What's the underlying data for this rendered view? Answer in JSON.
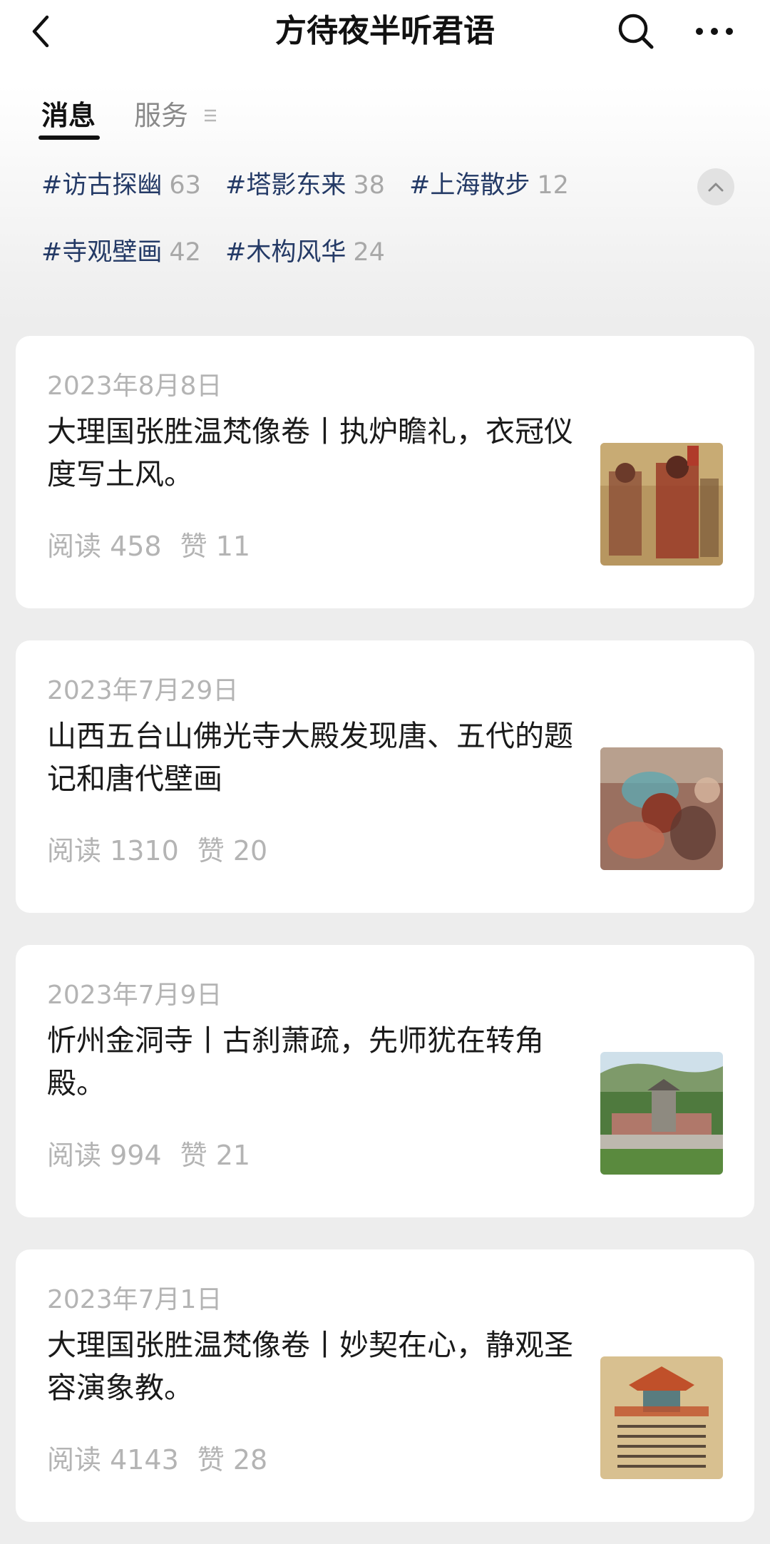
{
  "header": {
    "title": "方待夜半听君语",
    "back_icon": "chevron-left-icon",
    "search_icon": "search-icon",
    "more_icon": "more-dots-icon"
  },
  "tabs": {
    "messages": "消息",
    "services": "服务"
  },
  "tags": [
    {
      "name": "#访古探幽",
      "count": "63"
    },
    {
      "name": "#塔影东来",
      "count": "38"
    },
    {
      "name": "#上海散步",
      "count": "12"
    },
    {
      "name": "#寺观壁画",
      "count": "42"
    },
    {
      "name": "#木构风华",
      "count": "24"
    }
  ],
  "articles": [
    {
      "date": "2023年8月8日",
      "title": "大理国张胜温梵像卷丨执炉瞻礼，衣冠仪度写土风。",
      "reads": "阅读 458",
      "likes": "赞 11"
    },
    {
      "date": "2023年7月29日",
      "title": "山西五台山佛光寺大殿发现唐、五代的题记和唐代壁画",
      "reads": "阅读 1310",
      "likes": "赞 20"
    },
    {
      "date": "2023年7月9日",
      "title": "忻州金洞寺丨古刹萧疏，先师犹在转角殿。",
      "reads": "阅读 994",
      "likes": "赞 21"
    },
    {
      "date": "2023年7月1日",
      "title": "大理国张胜温梵像卷丨妙契在心，静观圣容演象教。",
      "reads": "阅读 4143",
      "likes": "赞 28"
    }
  ],
  "colors": {
    "background": "#ededed",
    "card": "#ffffff",
    "tag_text": "#243a66",
    "muted_text": "#b4b4b4"
  }
}
